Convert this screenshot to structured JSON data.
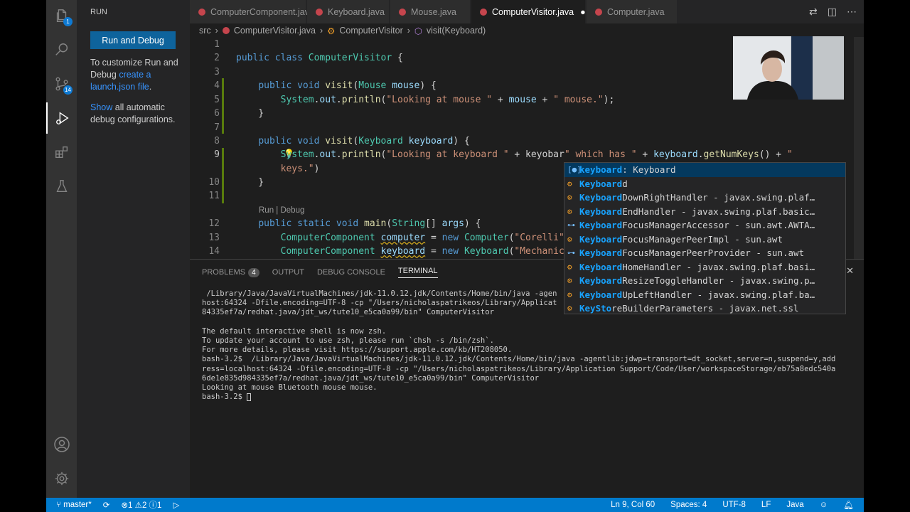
{
  "sidebar": {
    "title": "RUN",
    "run_button": "Run and Debug",
    "text1": "To customize Run and Debug ",
    "link1": "create a launch.json file",
    "text1_end": ".",
    "link2": "Show",
    "text2": " all automatic debug configurations."
  },
  "activity": {
    "badge_scm": "1",
    "badge_ext": "14"
  },
  "tabs": [
    {
      "label": "ComputerComponent.java"
    },
    {
      "label": "Keyboard.java"
    },
    {
      "label": "Mouse.java"
    },
    {
      "label": "ComputerVisitor.java",
      "dirty": "●"
    },
    {
      "label": "Computer.java"
    }
  ],
  "breadcrumb": {
    "root": "src",
    "file": "ComputerVisitor.java",
    "class": "ComputerVisitor",
    "method": "visit(Keyboard)"
  },
  "editor": {
    "line_numbers": [
      "1",
      "2",
      "3",
      "4",
      "5",
      "6",
      "7",
      "8",
      "9",
      "",
      "10",
      "11",
      "12",
      "13",
      "14"
    ],
    "codelens": "Run | Debug"
  },
  "suggestions": [
    {
      "match": "keyboard",
      "rest": " : Keyboard"
    },
    {
      "match": "Keyboard",
      "rest": "d"
    },
    {
      "match": "Keyboard",
      "rest": "DownRightHandler - javax.swing.plaf…"
    },
    {
      "match": "Keyboard",
      "rest": "EndHandler - javax.swing.plaf.basic…"
    },
    {
      "match": "Keyboard",
      "rest": "FocusManagerAccessor - sun.awt.AWTA…"
    },
    {
      "match": "Keyboard",
      "rest": "FocusManagerPeerImpl - sun.awt"
    },
    {
      "match": "Keyboard",
      "rest": "FocusManagerPeerProvider - sun.awt"
    },
    {
      "match": "Keyboard",
      "rest": "HomeHandler - javax.swing.plaf.basi…"
    },
    {
      "match": "Keyboard",
      "rest": "ResizeToggleHandler - javax.swing.p…"
    },
    {
      "match": "Keyboard",
      "rest": "UpLeftHandler - javax.swing.plaf.ba…"
    },
    {
      "match": "KeySto",
      "rest": "reBuilderParameters - javax.net.ssl"
    }
  ],
  "panel": {
    "tabs": [
      "PROBLEMS",
      "OUTPUT",
      "DEBUG CONSOLE",
      "TERMINAL"
    ],
    "problems_count": "4",
    "terminal_lines": [
      " /Library/Java/JavaVirtualMachines/jdk-11.0.12.jdk/Contents/Home/bin/java -agen",
      "host:64324 -Dfile.encoding=UTF-8 -cp \"/Users/nicholaspatrikeos/Library/Applicat",
      "84335ef7a/redhat.java/jdt_ws/tute10_e5ca0a99/bin\" ComputerVisitor",
      "",
      "The default interactive shell is now zsh.",
      "To update your account to use zsh, please run `chsh -s /bin/zsh`.",
      "For more details, please visit https://support.apple.com/kb/HT208050.",
      "bash-3.2$  /Library/Java/JavaVirtualMachines/jdk-11.0.12.jdk/Contents/Home/bin/java -agentlib:jdwp=transport=dt_socket,server=n,suspend=y,add",
      "ress=localhost:64324 -Dfile.encoding=UTF-8 -cp \"/Users/nicholaspatrikeos/Library/Application Support/Code/User/workspaceStorage/eb75a8edc540a",
      "6de1e835d984335ef7a/redhat.java/jdt_ws/tute10_e5ca0a99/bin\" ComputerVisitor",
      "Looking at mouse Bluetooth mouse mouse."
    ],
    "prompt": "bash-3.2$ "
  },
  "status": {
    "branch": "master*",
    "errors": "1",
    "warnings": "2",
    "infos": "1",
    "position": "Ln 9, Col 60",
    "spaces": "Spaces: 4",
    "encoding": "UTF-8",
    "eol": "LF",
    "language": "Java"
  }
}
